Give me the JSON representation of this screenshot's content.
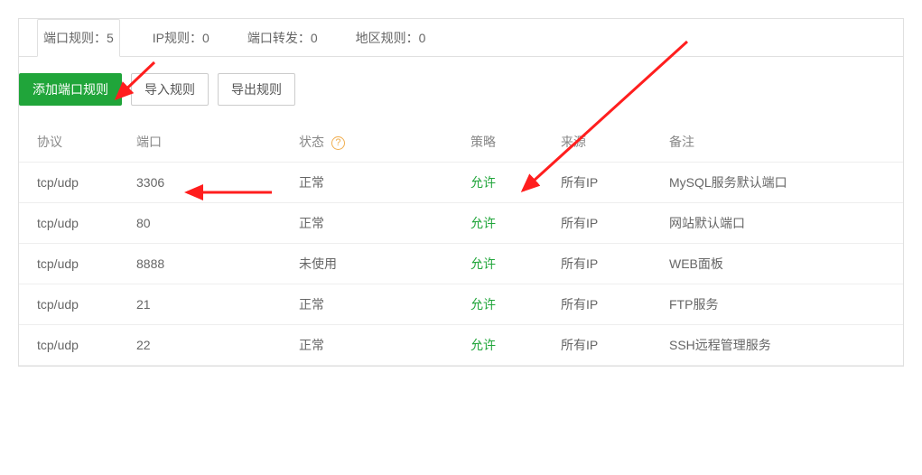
{
  "tabs": [
    {
      "label": "端口规则",
      "count": 5,
      "active": true
    },
    {
      "label": "IP规则",
      "count": 0,
      "active": false
    },
    {
      "label": "端口转发",
      "count": 0,
      "active": false
    },
    {
      "label": "地区规则",
      "count": 0,
      "active": false
    }
  ],
  "toolbar": {
    "add": "添加端口规则",
    "import": "导入规则",
    "export": "导出规则"
  },
  "columns": {
    "protocol": "协议",
    "port": "端口",
    "status": "状态",
    "policy": "策略",
    "source": "来源",
    "note": "备注"
  },
  "status_help": "?",
  "rows": [
    {
      "protocol": "tcp/udp",
      "port": "3306",
      "status": "正常",
      "policy": "允许",
      "source": "所有IP",
      "note": "MySQL服务默认端口"
    },
    {
      "protocol": "tcp/udp",
      "port": "80",
      "status": "正常",
      "policy": "允许",
      "source": "所有IP",
      "note": "网站默认端口"
    },
    {
      "protocol": "tcp/udp",
      "port": "8888",
      "status": "未使用",
      "policy": "允许",
      "source": "所有IP",
      "note": "WEB面板"
    },
    {
      "protocol": "tcp/udp",
      "port": "21",
      "status": "正常",
      "policy": "允许",
      "source": "所有IP",
      "note": "FTP服务"
    },
    {
      "protocol": "tcp/udp",
      "port": "22",
      "status": "正常",
      "policy": "允许",
      "source": "所有IP",
      "note": "SSH远程管理服务"
    }
  ]
}
